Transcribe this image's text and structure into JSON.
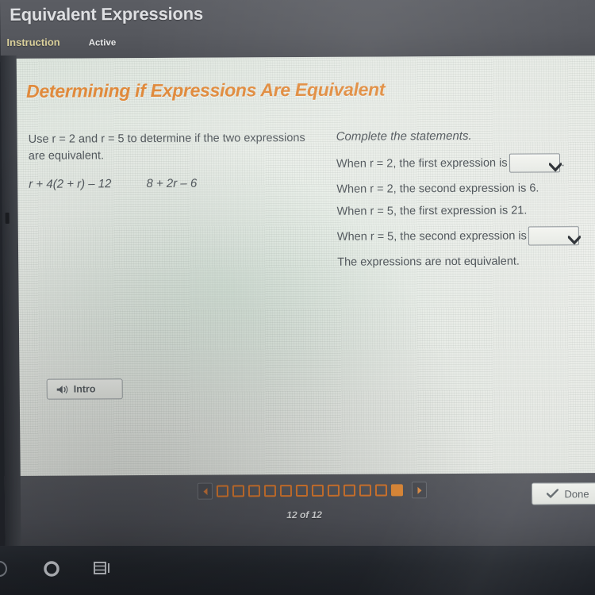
{
  "header": {
    "app_title": "Equivalent Expressions",
    "tab_instruction": "Instruction",
    "tab_active": "Active"
  },
  "lesson": {
    "title": "Determining if Expressions Are Equivalent"
  },
  "left_panel": {
    "prompt_line1": "Use r = 2 and r = 5 to determine if the two expressions",
    "prompt_line2": "are equivalent.",
    "expression_1": "r + 4(2 + r) – 12",
    "expression_2": "8 + 2r – 6"
  },
  "right_panel": {
    "heading": "Complete the statements.",
    "statements": [
      {
        "before": "When r = 2, the first expression is",
        "has_dropdown": true,
        "after": ".",
        "value": ""
      },
      {
        "before": "When r = 2, the second expression is 6.",
        "has_dropdown": false,
        "after": "",
        "value": ""
      },
      {
        "before": "When r = 5, the first expression is 21.",
        "has_dropdown": false,
        "after": "",
        "value": ""
      },
      {
        "before": "When r = 5, the second expression is",
        "has_dropdown": true,
        "after": "",
        "value": ""
      },
      {
        "before": "The expressions are not equivalent.",
        "has_dropdown": false,
        "after": "",
        "value": ""
      }
    ]
  },
  "toolbar": {
    "intro_label": "Intro",
    "intro_icon": "speaker-icon",
    "done_label": "Done",
    "done_icon": "check-icon"
  },
  "pagination": {
    "prev_icon": "triangle-left-icon",
    "next_icon": "triangle-right-icon",
    "page_text": "12 of 12",
    "total": 12,
    "current": 12,
    "accent_color": "#e08b3a"
  },
  "taskbar": {
    "start_icon": "start-icon",
    "cortana_icon": "cortana-circle-icon",
    "taskview_icon": "task-view-icon"
  },
  "colors": {
    "orange": "#e08a3c",
    "header_bg": "#56585e",
    "page_bg": "#eef0ec",
    "body_text": "#4e5459",
    "instruction_tab": "#d9cf9a"
  }
}
